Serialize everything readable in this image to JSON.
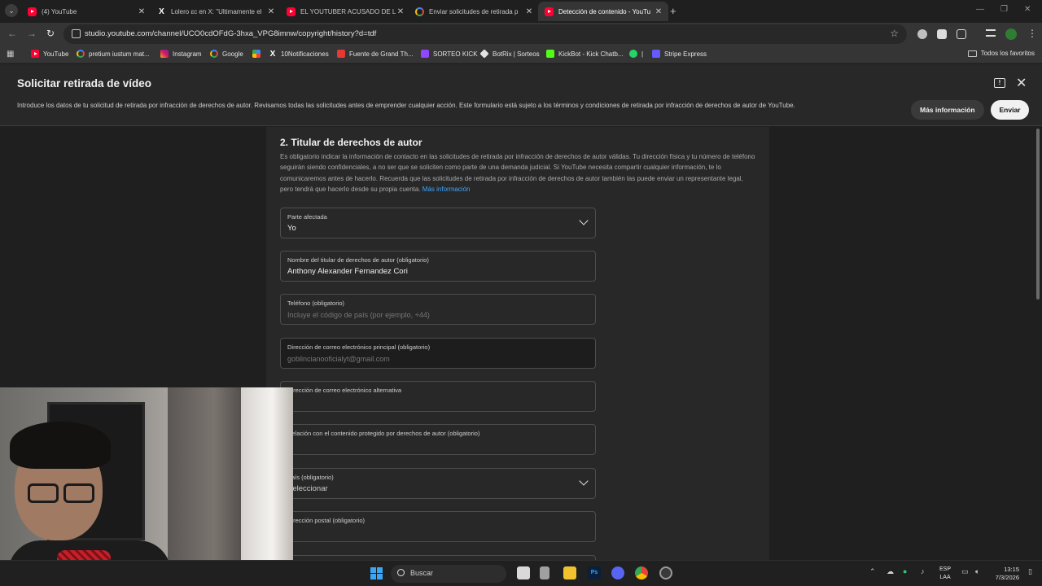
{
  "browser": {
    "tabs": [
      {
        "label": "(4) YouTube",
        "favicon": "youtube-icon",
        "active": false
      },
      {
        "label": "Lolero ɛc en X: \"Ultimamente el",
        "favicon": "x-icon",
        "active": false
      },
      {
        "label": "EL YOUTUBER ACUSADO DE LO",
        "favicon": "youtube-icon",
        "active": false
      },
      {
        "label": "Enviar solicitudes de retirada p",
        "favicon": "google-icon",
        "active": false
      },
      {
        "label": "Detección de contenido - YouTu",
        "favicon": "youtube-icon",
        "active": true
      }
    ],
    "new_tab": "+",
    "address": "studio.youtube.com/channel/UCO0cdOFdG-3hxa_VPG8imnw/copyright/history?d=tdf",
    "bookmarks": [
      {
        "label": "YouTube",
        "icon": "youtube-icon"
      },
      {
        "label": "pretium iustum mat...",
        "icon": "google-icon"
      },
      {
        "label": "Instagram",
        "icon": "instagram-icon"
      },
      {
        "label": "Google",
        "icon": "google-icon"
      },
      {
        "label": "",
        "icon": "pinwheel-icon"
      },
      {
        "label": "10Notificaciones",
        "icon": "x-icon"
      },
      {
        "label": "Fuente de Grand Th...",
        "icon": "rockstar-icon"
      },
      {
        "label": "SORTEO KICK",
        "icon": "twitch-icon"
      },
      {
        "label": "BotRix | Sorteos",
        "icon": "botrix-icon"
      },
      {
        "label": "KickBot - Kick Chatb...",
        "icon": "kickbot-icon"
      },
      {
        "label": "|",
        "icon": "whatsapp-icon"
      },
      {
        "label": "Stripe Express",
        "icon": "stripe-icon"
      }
    ],
    "all_bookmarks": "Todos los favoritos"
  },
  "dialog": {
    "title": "Solicitar retirada de vídeo",
    "description": "Introduce los datos de tu solicitud de retirada por infracción de derechos de autor. Revisamos todas las solicitudes antes de emprender cualquier acción. Este formulario está sujeto a los términos y condiciones de retirada por infracción de derechos de autor de YouTube.",
    "more_info_button": "Más información",
    "send_button": "Enviar"
  },
  "section": {
    "title": "2. Titular de derechos de autor",
    "text": "Es obligatorio indicar la información de contacto en las solicitudes de retirada por infracción de derechos de autor válidas. Tu dirección física y tu número de teléfono seguirán siendo confidenciales, a no ser que se soliciten como parte de una demanda judicial. Si YouTube necesita compartir cualquier información, te lo comunicaremos antes de hacerlo. Recuerda que las solicitudes de retirada por infracción de derechos de autor también las puede enviar un representante legal, pero tendrá que hacerlo desde su propia cuenta. ",
    "link": "Más información"
  },
  "fields": {
    "affected_party": {
      "label": "Parte afectada",
      "value": "Yo"
    },
    "holder_name": {
      "label": "Nombre del titular de derechos de autor (obligatorio)",
      "value": "Anthony Alexander Fernandez Cori"
    },
    "phone": {
      "label": "Teléfono (obligatorio)",
      "placeholder": "Incluye el código de país (por ejemplo, +44)"
    },
    "primary_email": {
      "label": "Dirección de correo electrónico principal (obligatorio)",
      "value": "goblincianooficialyt@gmail.com"
    },
    "alt_email": {
      "label": "Dirección de correo electrónico alternativa"
    },
    "relation": {
      "label": "Relación con el contenido protegido por derechos de autor (obligatorio)"
    },
    "country": {
      "label": "País (obligatorio)",
      "value": "Seleccionar"
    },
    "postal_address": {
      "label": "Dirección postal (obligatorio)"
    }
  },
  "taskbar": {
    "search_label": "Buscar",
    "language_1": "ESP",
    "language_2": "LAA",
    "time": "13:15",
    "date": "7/3/2026"
  },
  "colors": {
    "accent_link": "#3ea6ff",
    "youtube_red": "#ff0033",
    "windows_blue": "#3ba6f5"
  }
}
